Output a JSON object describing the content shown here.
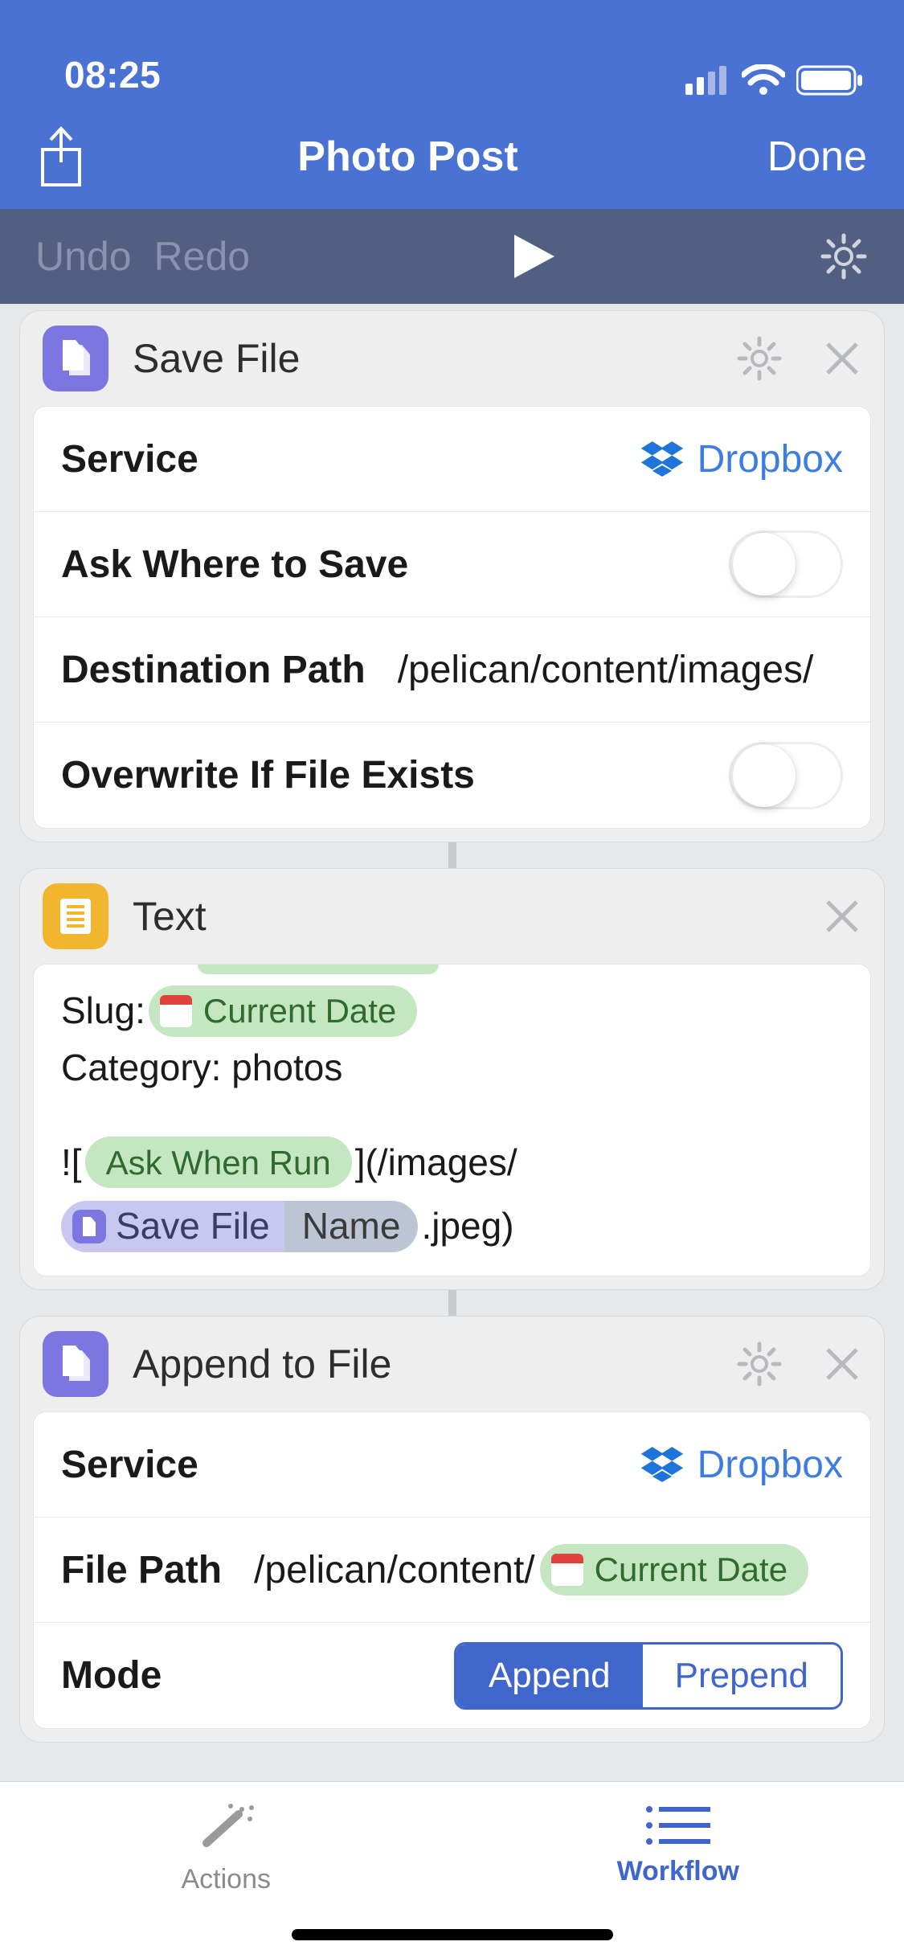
{
  "status": {
    "time": "08:25"
  },
  "nav": {
    "title": "Photo Post",
    "done": "Done"
  },
  "toolbar": {
    "undo": "Undo",
    "redo": "Redo"
  },
  "cards": {
    "save_file": {
      "title": "Save File",
      "rows": {
        "service_label": "Service",
        "service_value": "Dropbox",
        "ask_label": "Ask Where to Save",
        "dest_label": "Destination Path",
        "dest_value": "/pelican/content/images/",
        "overwrite_label": "Overwrite If File Exists"
      }
    },
    "text": {
      "title": "Text",
      "slug_label": "Slug: ",
      "current_date": "Current Date",
      "category_line": "Category: photos",
      "bang_open": "![",
      "ask_when_run": "Ask When Run",
      "close_path": "](/images/",
      "save_file_token": "Save File",
      "name_token": "Name",
      "jpeg_tail": ".jpeg)"
    },
    "append": {
      "title": "Append to File",
      "service_label": "Service",
      "service_value": "Dropbox",
      "path_label": "File Path",
      "path_prefix": "/pelican/content/",
      "current_date": "Current Date",
      "mode_label": "Mode",
      "mode_append": "Append",
      "mode_prepend": "Prepend"
    }
  },
  "tabs": {
    "actions": "Actions",
    "workflow": "Workflow"
  }
}
